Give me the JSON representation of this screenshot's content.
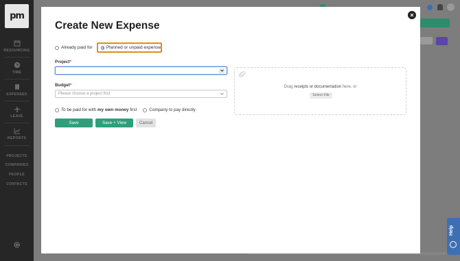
{
  "sidebar": {
    "logo_text": "pm",
    "nav": [
      {
        "icon": "calendar-icon",
        "label": "RESOURCING"
      },
      {
        "icon": "clock-icon",
        "label": "TIME"
      },
      {
        "icon": "receipt-icon",
        "label": "EXPENSES"
      },
      {
        "icon": "plane-icon",
        "label": "LEAVE"
      },
      {
        "icon": "chart-icon",
        "label": "REPORTS"
      }
    ],
    "links": [
      "PROJECTS",
      "COMPANIES",
      "PEOPLE",
      "CONTACTS"
    ],
    "settings_icon": "gear-icon"
  },
  "background": {
    "help_label": "Help",
    "accent_green": "#2e8b6c",
    "accent_purple": "#5b45a8",
    "accent_blue": "#3f6fb3"
  },
  "modal": {
    "title": "Create New Expense",
    "payment_status": {
      "options": [
        "Already paid for",
        "Planned or unpaid expense"
      ],
      "selected": "Planned or unpaid expense"
    },
    "project": {
      "label": "Project",
      "required_mark": "*",
      "value": ""
    },
    "budget": {
      "label": "Budget",
      "required_mark": "*",
      "placeholder": "Please choose a project first"
    },
    "payer": {
      "option_1_prefix": "To be paid for with ",
      "option_1_bold": "my own money",
      "option_1_suffix": " first",
      "option_2": "Company to pay directly",
      "selected": null
    },
    "buttons": {
      "save": "Save",
      "save_view": "Save + View",
      "cancel": "Cancel"
    },
    "dropzone": {
      "text_prefix": "Drag ",
      "text_bold": "receipts or documentation",
      "text_suffix": " here, or",
      "select_file": "Select File"
    },
    "accent_green": "#2e9e7b",
    "highlight_orange": "#e58a16"
  }
}
